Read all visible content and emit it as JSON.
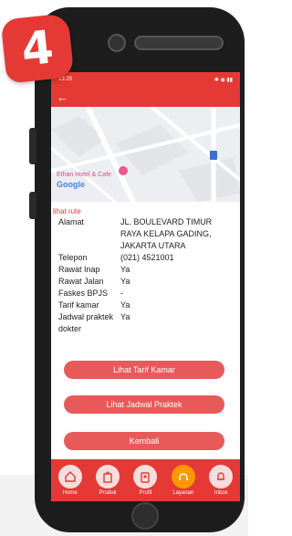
{
  "badge": {
    "number": "4"
  },
  "status_bar": {
    "left": "13:29",
    "right": ""
  },
  "app_bar": {
    "back_icon": "arrow-left-icon"
  },
  "map": {
    "place_label": "Ethan Hotel & Cafe",
    "google_label": "Google"
  },
  "section_link": "lihat rute",
  "info": {
    "alamat": {
      "label": "Alamat",
      "value": "JL. BOULEVARD TIMUR RAYA KELAPA GADING, JAKARTA UTARA"
    },
    "telepon": {
      "label": "Telepon",
      "value": "(021) 4521001"
    },
    "rawat_inap": {
      "label": "Rawat Inap",
      "value": "Ya"
    },
    "rawat_jalan": {
      "label": "Rawat Jalan",
      "value": "Ya"
    },
    "faskes_bpjs": {
      "label": "Faskes BPJS",
      "value": "-"
    },
    "tarif_kamar": {
      "label": "Tarif kamar",
      "value": "Ya"
    },
    "jadwal_praktek": {
      "label": "Jadwal praktek dokter",
      "value": "Ya"
    }
  },
  "buttons": {
    "tarif": "Lihat Tarif Kamar",
    "jadwal": "Lihat Jadwal Praktek",
    "kembali": "Kembali"
  },
  "nav": {
    "home": "Home",
    "produk": "Produk",
    "profil": "Profil",
    "layanan": "Layanan",
    "inbox": "Inbox"
  },
  "colors": {
    "primary": "#e53935",
    "button": "#e85a5a",
    "active": "#ff9800"
  }
}
